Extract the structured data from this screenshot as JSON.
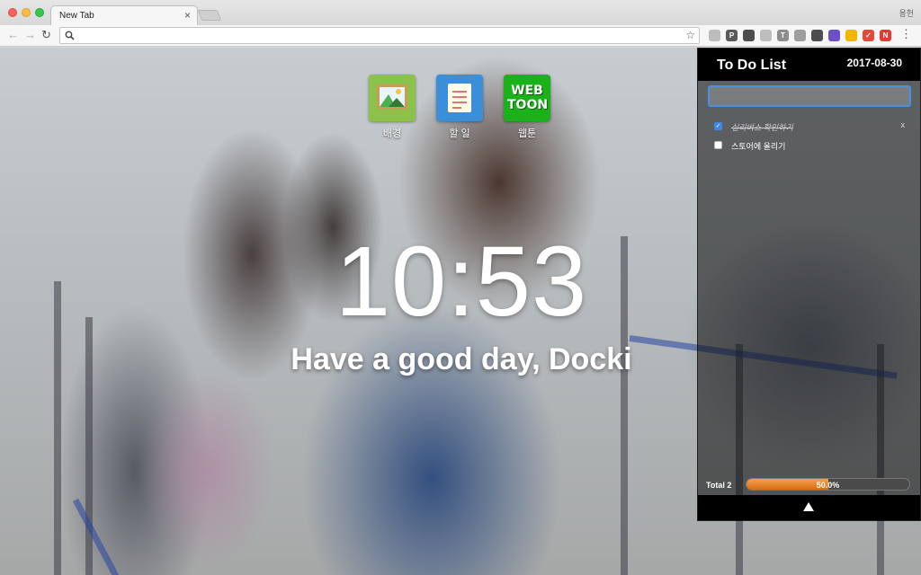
{
  "browser": {
    "tab_title": "New Tab",
    "tab_close": "×",
    "profile_name": "용헌",
    "address_value": "",
    "back_glyph": "←",
    "forward_glyph": "→",
    "reload_glyph": "↻",
    "star_glyph": "☆",
    "menu_glyph": "⋮",
    "extensions": [
      {
        "name": "cast-icon",
        "color": "#bdbdbd",
        "label": ""
      },
      {
        "name": "pinterest-icon",
        "color": "#5a5a5a",
        "label": "P"
      },
      {
        "name": "eyedropper-icon",
        "color": "#4c4c4c",
        "label": ""
      },
      {
        "name": "bookmark-star-icon",
        "color": "#bdbdbd",
        "label": ""
      },
      {
        "name": "text-icon",
        "color": "#8d8d8d",
        "label": "T"
      },
      {
        "name": "columns-icon",
        "color": "#9e9e9e",
        "label": ""
      },
      {
        "name": "evernote-icon",
        "color": "#4d4d4d",
        "label": ""
      },
      {
        "name": "circle-ext-icon",
        "color": "#6d4fc7",
        "label": ""
      },
      {
        "name": "dots-ext-icon",
        "color": "#f2b600",
        "label": ""
      },
      {
        "name": "check-ext-icon",
        "color": "#e24a3b",
        "label": "✓"
      },
      {
        "name": "n-ext-icon",
        "color": "#e23b2f",
        "label": "N"
      }
    ]
  },
  "shortcuts": [
    {
      "label": "배경"
    },
    {
      "label": "할 일"
    },
    {
      "label": "웹툰",
      "tile_top": "WEB",
      "tile_bottom": "TOON"
    }
  ],
  "clock": {
    "time": "10:53",
    "greeting": "Have a good day, Docki"
  },
  "todo": {
    "title": "To Do List",
    "date": "2017-08-30",
    "input_value": "",
    "items": [
      {
        "text": "실리버스 확인하기",
        "done": true,
        "delete_label": "x"
      },
      {
        "text": "스토어에 올리기",
        "done": false,
        "delete_label": ""
      }
    ],
    "total_label": "Total 2",
    "progress": 0.5,
    "progress_label": "50.0%",
    "progress_color": "#e8852a"
  }
}
